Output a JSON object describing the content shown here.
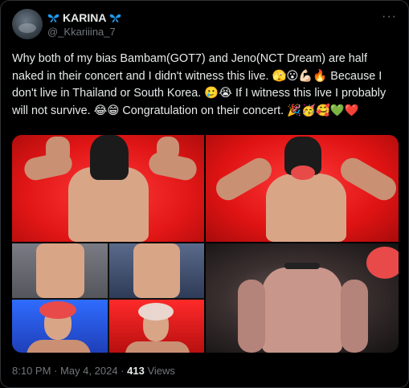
{
  "author": {
    "display_name": "KARINA",
    "handle": "@_Kkariiina_7",
    "avatar_icon": "avatar-photo",
    "name_icon": "blue-butterfly-icon"
  },
  "menu": {
    "more_label": "···"
  },
  "tweet": {
    "text": "Why both of my bias Bambam(GOT7) and Jeno(NCT Dream) are half naked in their concert and I didn't witness this live. 🫣😮💪🏻🔥 Because I don't live in Thailand or South Korea. 🥲😭 If I witness this live I probably will not survive. 😂😁 Congratulation on their concert. 🎉🥳🥰💚❤️"
  },
  "media": {
    "images": [
      {
        "label": "concert-photo-shirtless-cap-red-background"
      },
      {
        "label": "concert-photo-back-flexing-red-background"
      },
      {
        "label": "concert-photo-collage-four-panels"
      },
      {
        "label": "concert-photo-shirtless-dark-background"
      }
    ]
  },
  "meta": {
    "time": "8:10 PM",
    "separator": "·",
    "date": "May 4, 2024",
    "views_count": "413",
    "views_label": "Views"
  },
  "colors": {
    "background": "#000000",
    "text_primary": "#e7e9ea",
    "text_secondary": "#71767b",
    "border": "#2f3336",
    "butterfly_blue": "#1d9bf0"
  }
}
